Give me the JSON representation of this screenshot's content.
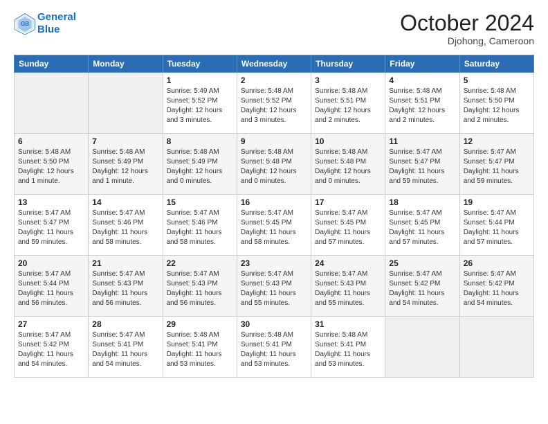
{
  "header": {
    "logo_line1": "General",
    "logo_line2": "Blue",
    "month": "October 2024",
    "location": "Djohong, Cameroon"
  },
  "days_of_week": [
    "Sunday",
    "Monday",
    "Tuesday",
    "Wednesday",
    "Thursday",
    "Friday",
    "Saturday"
  ],
  "weeks": [
    [
      {
        "day": "",
        "info": ""
      },
      {
        "day": "",
        "info": ""
      },
      {
        "day": "1",
        "info": "Sunrise: 5:49 AM\nSunset: 5:52 PM\nDaylight: 12 hours and 3 minutes."
      },
      {
        "day": "2",
        "info": "Sunrise: 5:48 AM\nSunset: 5:52 PM\nDaylight: 12 hours and 3 minutes."
      },
      {
        "day": "3",
        "info": "Sunrise: 5:48 AM\nSunset: 5:51 PM\nDaylight: 12 hours and 2 minutes."
      },
      {
        "day": "4",
        "info": "Sunrise: 5:48 AM\nSunset: 5:51 PM\nDaylight: 12 hours and 2 minutes."
      },
      {
        "day": "5",
        "info": "Sunrise: 5:48 AM\nSunset: 5:50 PM\nDaylight: 12 hours and 2 minutes."
      }
    ],
    [
      {
        "day": "6",
        "info": "Sunrise: 5:48 AM\nSunset: 5:50 PM\nDaylight: 12 hours and 1 minute."
      },
      {
        "day": "7",
        "info": "Sunrise: 5:48 AM\nSunset: 5:49 PM\nDaylight: 12 hours and 1 minute."
      },
      {
        "day": "8",
        "info": "Sunrise: 5:48 AM\nSunset: 5:49 PM\nDaylight: 12 hours and 0 minutes."
      },
      {
        "day": "9",
        "info": "Sunrise: 5:48 AM\nSunset: 5:48 PM\nDaylight: 12 hours and 0 minutes."
      },
      {
        "day": "10",
        "info": "Sunrise: 5:48 AM\nSunset: 5:48 PM\nDaylight: 12 hours and 0 minutes."
      },
      {
        "day": "11",
        "info": "Sunrise: 5:47 AM\nSunset: 5:47 PM\nDaylight: 11 hours and 59 minutes."
      },
      {
        "day": "12",
        "info": "Sunrise: 5:47 AM\nSunset: 5:47 PM\nDaylight: 11 hours and 59 minutes."
      }
    ],
    [
      {
        "day": "13",
        "info": "Sunrise: 5:47 AM\nSunset: 5:47 PM\nDaylight: 11 hours and 59 minutes."
      },
      {
        "day": "14",
        "info": "Sunrise: 5:47 AM\nSunset: 5:46 PM\nDaylight: 11 hours and 58 minutes."
      },
      {
        "day": "15",
        "info": "Sunrise: 5:47 AM\nSunset: 5:46 PM\nDaylight: 11 hours and 58 minutes."
      },
      {
        "day": "16",
        "info": "Sunrise: 5:47 AM\nSunset: 5:45 PM\nDaylight: 11 hours and 58 minutes."
      },
      {
        "day": "17",
        "info": "Sunrise: 5:47 AM\nSunset: 5:45 PM\nDaylight: 11 hours and 57 minutes."
      },
      {
        "day": "18",
        "info": "Sunrise: 5:47 AM\nSunset: 5:45 PM\nDaylight: 11 hours and 57 minutes."
      },
      {
        "day": "19",
        "info": "Sunrise: 5:47 AM\nSunset: 5:44 PM\nDaylight: 11 hours and 57 minutes."
      }
    ],
    [
      {
        "day": "20",
        "info": "Sunrise: 5:47 AM\nSunset: 5:44 PM\nDaylight: 11 hours and 56 minutes."
      },
      {
        "day": "21",
        "info": "Sunrise: 5:47 AM\nSunset: 5:43 PM\nDaylight: 11 hours and 56 minutes."
      },
      {
        "day": "22",
        "info": "Sunrise: 5:47 AM\nSunset: 5:43 PM\nDaylight: 11 hours and 56 minutes."
      },
      {
        "day": "23",
        "info": "Sunrise: 5:47 AM\nSunset: 5:43 PM\nDaylight: 11 hours and 55 minutes."
      },
      {
        "day": "24",
        "info": "Sunrise: 5:47 AM\nSunset: 5:43 PM\nDaylight: 11 hours and 55 minutes."
      },
      {
        "day": "25",
        "info": "Sunrise: 5:47 AM\nSunset: 5:42 PM\nDaylight: 11 hours and 54 minutes."
      },
      {
        "day": "26",
        "info": "Sunrise: 5:47 AM\nSunset: 5:42 PM\nDaylight: 11 hours and 54 minutes."
      }
    ],
    [
      {
        "day": "27",
        "info": "Sunrise: 5:47 AM\nSunset: 5:42 PM\nDaylight: 11 hours and 54 minutes."
      },
      {
        "day": "28",
        "info": "Sunrise: 5:47 AM\nSunset: 5:41 PM\nDaylight: 11 hours and 54 minutes."
      },
      {
        "day": "29",
        "info": "Sunrise: 5:48 AM\nSunset: 5:41 PM\nDaylight: 11 hours and 53 minutes."
      },
      {
        "day": "30",
        "info": "Sunrise: 5:48 AM\nSunset: 5:41 PM\nDaylight: 11 hours and 53 minutes."
      },
      {
        "day": "31",
        "info": "Sunrise: 5:48 AM\nSunset: 5:41 PM\nDaylight: 11 hours and 53 minutes."
      },
      {
        "day": "",
        "info": ""
      },
      {
        "day": "",
        "info": ""
      }
    ]
  ]
}
